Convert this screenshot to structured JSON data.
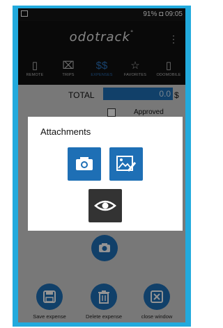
{
  "status": {
    "right_text": "91% ◘ 09:05"
  },
  "app": {
    "logo_left": "odo",
    "logo_right": "track",
    "logo_mark": "°"
  },
  "tabs": [
    {
      "label": "REMOTE"
    },
    {
      "label": "TRIPS"
    },
    {
      "label": "EXPENSES"
    },
    {
      "label": "FAVORITES"
    },
    {
      "label": "ODOMOBILE"
    }
  ],
  "form": {
    "total_label": "TOTAL",
    "total_value": "0.0",
    "currency": "$",
    "approved_label": "Approved"
  },
  "dialog": {
    "title": "Attachments"
  },
  "bottom": {
    "save_label": "Save expense",
    "delete_label": "Delete expense",
    "close_label": "close window"
  },
  "icons": {
    "camera": "camera-icon",
    "gallery": "gallery-icon",
    "view": "eye-icon",
    "save": "save-icon",
    "delete": "trash-icon",
    "close": "close-icon"
  },
  "colors": {
    "accent": "#1e6fb5",
    "frame": "#22aadd",
    "dialog_dark_button": "#333333"
  }
}
